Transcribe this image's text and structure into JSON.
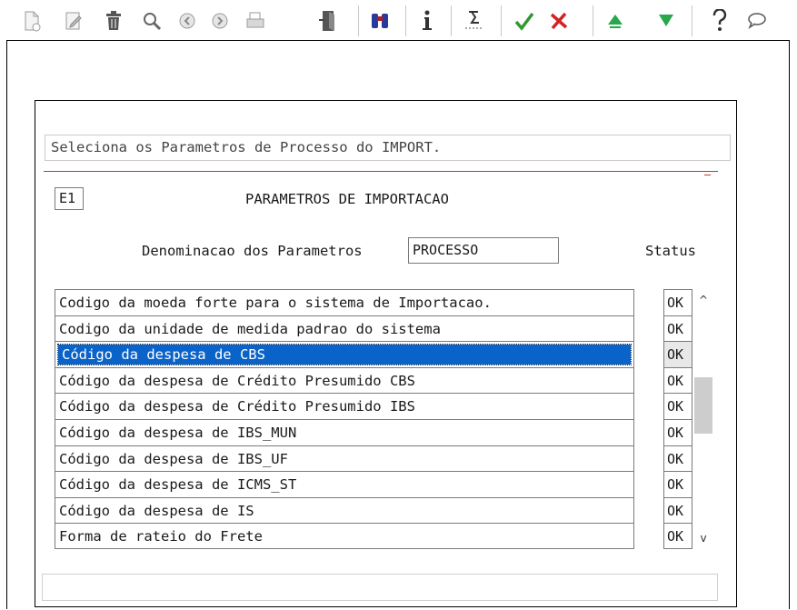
{
  "toolbar": {
    "icons": [
      "new-document-icon",
      "edit-icon",
      "delete-trash-icon",
      "search-icon",
      "previous-icon",
      "next-icon",
      "print-icon",
      "exit-door-icon",
      "binoculars-icon",
      "info-icon",
      "sum-icon",
      "confirm-check-icon",
      "cancel-x-icon",
      "up-arrow-icon",
      "down-arrow-icon",
      "help-question-icon",
      "comment-bubble-icon"
    ],
    "colors": {
      "confirm": "#2e9a2e",
      "cancel": "#d22222",
      "arrow": "#27a84a",
      "info": "#1a1a1a"
    }
  },
  "message": "Seleciona os Parametros de Processo do IMPORT.",
  "screen_code": "E1",
  "screen_title": "PARAMETROS DE IMPORTACAO",
  "param_label": "Denominacao dos Parametros",
  "param_value": "PROCESSO",
  "status_header": "Status",
  "rows": [
    {
      "label": "Codigo da moeda forte para o sistema de Importacao.",
      "status": "OK"
    },
    {
      "label": "Codigo da unidade de medida padrao do sistema",
      "status": "OK"
    },
    {
      "label": "Código da despesa de CBS",
      "status": "OK"
    },
    {
      "label": "Código da despesa de Crédito Presumido CBS",
      "status": "OK"
    },
    {
      "label": "Código da despesa de Crédito Presumido IBS",
      "status": "OK"
    },
    {
      "label": "Código da despesa de IBS_MUN",
      "status": "OK"
    },
    {
      "label": "Código da despesa de IBS_UF",
      "status": "OK"
    },
    {
      "label": "Código da despesa de ICMS_ST",
      "status": "OK"
    },
    {
      "label": "Código da despesa de IS",
      "status": "OK"
    },
    {
      "label": "Forma de rateio do Frete",
      "status": "OK"
    }
  ],
  "selected_row_index": 2,
  "selection_color": "#0a63c9",
  "scroll": {
    "up_glyph": "^",
    "down_glyph": "v"
  }
}
